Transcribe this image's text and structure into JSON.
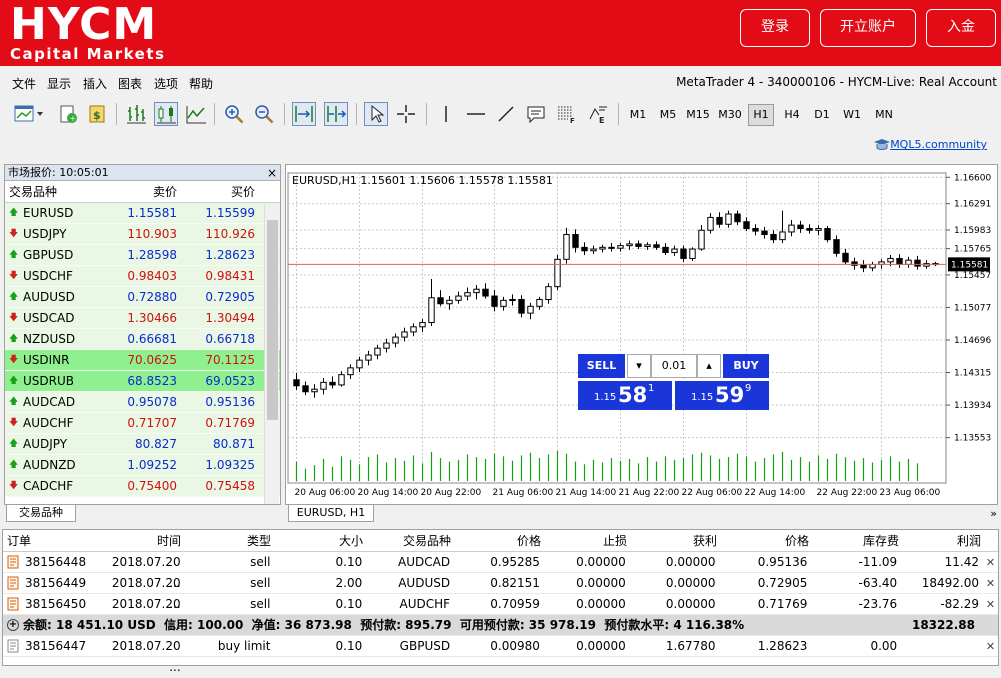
{
  "header": {
    "logo_main": "HYCM",
    "logo_sub": "Capital Markets",
    "login": "登录",
    "open_account": "开立账户",
    "deposit": "入金"
  },
  "menu": [
    "文件",
    "显示",
    "插入",
    "图表",
    "选项",
    "帮助"
  ],
  "terminal_title": "MetaTrader 4 - 340000106 - HYCM-Live: Real Account",
  "toolbar": {
    "timeframes": [
      "M1",
      "M5",
      "M15",
      "M30",
      "H1",
      "H4",
      "D1",
      "W1",
      "MN"
    ],
    "active_timeframe": "H1",
    "mql_link": "MQL5.community"
  },
  "market_watch": {
    "title": "市场报价: 10:05:01",
    "columns": [
      "交易品种",
      "卖价",
      "买价"
    ],
    "tab": "交易品种",
    "rows": [
      {
        "symbol": "EURUSD",
        "dir": "up",
        "bid": "1.15581",
        "ask": "1.15599",
        "color": "blue"
      },
      {
        "symbol": "USDJPY",
        "dir": "down",
        "bid": "110.903",
        "ask": "110.926",
        "color": "red"
      },
      {
        "symbol": "GBPUSD",
        "dir": "up",
        "bid": "1.28598",
        "ask": "1.28623",
        "color": "blue"
      },
      {
        "symbol": "USDCHF",
        "dir": "down",
        "bid": "0.98403",
        "ask": "0.98431",
        "color": "red"
      },
      {
        "symbol": "AUDUSD",
        "dir": "up",
        "bid": "0.72880",
        "ask": "0.72905",
        "color": "blue"
      },
      {
        "symbol": "USDCAD",
        "dir": "down",
        "bid": "1.30466",
        "ask": "1.30494",
        "color": "red"
      },
      {
        "symbol": "NZDUSD",
        "dir": "up",
        "bid": "0.66681",
        "ask": "0.66718",
        "color": "blue"
      },
      {
        "symbol": "USDINR",
        "dir": "down",
        "bid": "70.0625",
        "ask": "70.1125",
        "color": "red",
        "highlight": true
      },
      {
        "symbol": "USDRUB",
        "dir": "up",
        "bid": "68.8523",
        "ask": "69.0523",
        "color": "blue",
        "highlight": true
      },
      {
        "symbol": "AUDCAD",
        "dir": "up",
        "bid": "0.95078",
        "ask": "0.95136",
        "color": "blue"
      },
      {
        "symbol": "AUDCHF",
        "dir": "down",
        "bid": "0.71707",
        "ask": "0.71769",
        "color": "red"
      },
      {
        "symbol": "AUDJPY",
        "dir": "up",
        "bid": "80.827",
        "ask": "80.871",
        "color": "blue"
      },
      {
        "symbol": "AUDNZD",
        "dir": "up",
        "bid": "1.09252",
        "ask": "1.09325",
        "color": "blue"
      },
      {
        "symbol": "CADCHF",
        "dir": "down",
        "bid": "0.75400",
        "ask": "0.75458",
        "color": "red"
      }
    ]
  },
  "one_click": {
    "sell": "SELL",
    "buy": "BUY",
    "lot": "0.01",
    "sell_prefix": "1.15",
    "sell_big": "58",
    "sell_sup": "1",
    "buy_prefix": "1.15",
    "buy_big": "59",
    "buy_sup": "9"
  },
  "chart_tab": "EURUSD, H1",
  "chart_data": {
    "type": "candlestick",
    "header": "EURUSD,H1  1.15601 1.15606 1.15578 1.15581",
    "current_price_label": "1.15581",
    "current_price": 1.15581,
    "ylim": [
      1.1335,
      1.1665
    ],
    "y_ticks": [
      "1.16600",
      "1.16291",
      "1.15983",
      "1.15765",
      "1.15457",
      "1.15077",
      "1.14696",
      "1.14315",
      "1.13934",
      "1.13553"
    ],
    "y_tick_values": [
      1.166,
      1.16291,
      1.15983,
      1.15765,
      1.15457,
      1.15077,
      1.14696,
      1.14315,
      1.13934,
      1.13553
    ],
    "x_ticks": [
      "20 Aug 06:00",
      "20 Aug 14:00",
      "20 Aug 22:00",
      "21 Aug 06:00",
      "21 Aug 14:00",
      "21 Aug 22:00",
      "22 Aug 06:00",
      "22 Aug 14:00",
      "22 Aug 22:00",
      "23 Aug 06:00"
    ],
    "candles": [
      [
        1.1423,
        1.1431,
        1.1411,
        1.1416
      ],
      [
        1.1416,
        1.1421,
        1.1405,
        1.1409
      ],
      [
        1.1409,
        1.1418,
        1.1402,
        1.1412
      ],
      [
        1.1412,
        1.1425,
        1.1406,
        1.142
      ],
      [
        1.142,
        1.1427,
        1.1413,
        1.1417
      ],
      [
        1.1417,
        1.1433,
        1.1415,
        1.1429
      ],
      [
        1.1429,
        1.1441,
        1.1424,
        1.1437
      ],
      [
        1.1437,
        1.145,
        1.1432,
        1.1446
      ],
      [
        1.1446,
        1.1457,
        1.144,
        1.1452
      ],
      [
        1.1452,
        1.1464,
        1.1447,
        1.146
      ],
      [
        1.146,
        1.1471,
        1.1455,
        1.1466
      ],
      [
        1.1466,
        1.1477,
        1.1461,
        1.1473
      ],
      [
        1.1473,
        1.1484,
        1.1468,
        1.1479
      ],
      [
        1.1479,
        1.1489,
        1.1474,
        1.1485
      ],
      [
        1.1485,
        1.1494,
        1.1479,
        1.149
      ],
      [
        1.149,
        1.1541,
        1.1486,
        1.1519
      ],
      [
        1.1519,
        1.1528,
        1.1509,
        1.1512
      ],
      [
        1.1512,
        1.1521,
        1.1505,
        1.1516
      ],
      [
        1.1516,
        1.1526,
        1.1512,
        1.1521
      ],
      [
        1.1521,
        1.1531,
        1.1516,
        1.1525
      ],
      [
        1.1525,
        1.1534,
        1.1517,
        1.1529
      ],
      [
        1.1529,
        1.1536,
        1.1518,
        1.1521
      ],
      [
        1.1521,
        1.1528,
        1.1503,
        1.1509
      ],
      [
        1.1509,
        1.152,
        1.1504,
        1.1516
      ],
      [
        1.1516,
        1.1523,
        1.151,
        1.1517
      ],
      [
        1.1517,
        1.1522,
        1.1496,
        1.1501
      ],
      [
        1.1501,
        1.1513,
        1.1494,
        1.1509
      ],
      [
        1.1509,
        1.152,
        1.1505,
        1.1517
      ],
      [
        1.1517,
        1.1536,
        1.1512,
        1.1532
      ],
      [
        1.1532,
        1.1569,
        1.1528,
        1.1564
      ],
      [
        1.1564,
        1.1601,
        1.1559,
        1.1593
      ],
      [
        1.1593,
        1.1599,
        1.1572,
        1.1578
      ],
      [
        1.1578,
        1.1584,
        1.1569,
        1.1574
      ],
      [
        1.1574,
        1.158,
        1.157,
        1.1576
      ],
      [
        1.1576,
        1.1581,
        1.1572,
        1.1578
      ],
      [
        1.1578,
        1.1583,
        1.1573,
        1.1577
      ],
      [
        1.1577,
        1.1583,
        1.1573,
        1.158
      ],
      [
        1.158,
        1.1586,
        1.1575,
        1.1582
      ],
      [
        1.1582,
        1.1586,
        1.1576,
        1.1579
      ],
      [
        1.1579,
        1.1584,
        1.1575,
        1.1581
      ],
      [
        1.1581,
        1.1585,
        1.1575,
        1.1578
      ],
      [
        1.1578,
        1.1583,
        1.1569,
        1.1572
      ],
      [
        1.1572,
        1.158,
        1.1568,
        1.1576
      ],
      [
        1.1576,
        1.158,
        1.1561,
        1.1565
      ],
      [
        1.1565,
        1.1578,
        1.1562,
        1.1576
      ],
      [
        1.1576,
        1.1604,
        1.1574,
        1.1598
      ],
      [
        1.1598,
        1.1618,
        1.1594,
        1.1613
      ],
      [
        1.1613,
        1.1619,
        1.1601,
        1.1605
      ],
      [
        1.1605,
        1.1621,
        1.1601,
        1.1617
      ],
      [
        1.1617,
        1.1621,
        1.1604,
        1.1608
      ],
      [
        1.1608,
        1.1613,
        1.1597,
        1.16
      ],
      [
        1.16,
        1.1605,
        1.1592,
        1.1597
      ],
      [
        1.1597,
        1.1602,
        1.1588,
        1.1593
      ],
      [
        1.1593,
        1.1598,
        1.1583,
        1.1587
      ],
      [
        1.1587,
        1.1621,
        1.1583,
        1.1596
      ],
      [
        1.1596,
        1.161,
        1.1591,
        1.1604
      ],
      [
        1.1604,
        1.1609,
        1.1595,
        1.16
      ],
      [
        1.16,
        1.1605,
        1.1594,
        1.1598
      ],
      [
        1.1598,
        1.1604,
        1.1592,
        1.16
      ],
      [
        1.16,
        1.1603,
        1.1584,
        1.1587
      ],
      [
        1.1587,
        1.1592,
        1.1567,
        1.1571
      ],
      [
        1.1571,
        1.1576,
        1.1558,
        1.1561
      ],
      [
        1.1561,
        1.1566,
        1.1552,
        1.1557
      ],
      [
        1.1557,
        1.1563,
        1.1549,
        1.1554
      ],
      [
        1.1554,
        1.1561,
        1.155,
        1.1558
      ],
      [
        1.1558,
        1.1564,
        1.1553,
        1.1561
      ],
      [
        1.1561,
        1.1569,
        1.1556,
        1.1565
      ],
      [
        1.1565,
        1.157,
        1.1554,
        1.1558
      ],
      [
        1.1558,
        1.1567,
        1.1554,
        1.1563
      ],
      [
        1.1563,
        1.1568,
        1.1552,
        1.1556
      ],
      [
        1.1556,
        1.1563,
        1.1553,
        1.1559
      ],
      [
        1.1559,
        1.1561,
        1.1556,
        1.1558
      ]
    ],
    "volumes": [
      22,
      14,
      18,
      25,
      16,
      28,
      24,
      19,
      27,
      30,
      21,
      26,
      23,
      29,
      20,
      33,
      26,
      22,
      24,
      30,
      27,
      25,
      31,
      28,
      23,
      29,
      32,
      26,
      30,
      34,
      31,
      22,
      19,
      24,
      21,
      26,
      23,
      25,
      20,
      27,
      22,
      28,
      24,
      26,
      30,
      32,
      29,
      25,
      27,
      31,
      28,
      22,
      26,
      30,
      33,
      24,
      27,
      22,
      29,
      25,
      31,
      27,
      23,
      26,
      21,
      24,
      28,
      22,
      25,
      20
    ],
    "colors": {
      "line": "#000000",
      "bull": "#ffffff",
      "bear": "#000000",
      "volume": "#10a010",
      "price_line": "#d86a3a",
      "grid": "#c8c8c8"
    }
  },
  "trade": {
    "columns": [
      "订单",
      "时间",
      "类型",
      "大小",
      "交易品种",
      "价格",
      "止损",
      "获利",
      "价格",
      "库存费",
      "利润"
    ],
    "rows": [
      {
        "order": "38156448",
        "time": "2018.07.20 ...",
        "type": "sell",
        "size": "0.10",
        "symbol": "AUDCAD",
        "price": "0.95285",
        "sl": "0.00000",
        "tp": "0.00000",
        "cur": "0.95136",
        "swap": "-11.09",
        "profit": "11.42"
      },
      {
        "order": "38156449",
        "time": "2018.07.20 ...",
        "type": "sell",
        "size": "2.00",
        "symbol": "AUDUSD",
        "price": "0.82151",
        "sl": "0.00000",
        "tp": "0.00000",
        "cur": "0.72905",
        "swap": "-63.40",
        "profit": "18492.00"
      },
      {
        "order": "38156450",
        "time": "2018.07.20 ...",
        "type": "sell",
        "size": "0.10",
        "symbol": "AUDCHF",
        "price": "0.70959",
        "sl": "0.00000",
        "tp": "0.00000",
        "cur": "0.71769",
        "swap": "-23.76",
        "profit": "-82.29"
      }
    ],
    "balance_line": "余额: 18 451.10 USD  信用: 100.00  净值: 36 873.98  预付款: 895.79  可用预付款: 35 978.19  预付款水平: 4 116.38%",
    "balance_total": "18322.88",
    "pending": {
      "order": "38156447",
      "time": "2018.07.20 ...",
      "type": "buy limit",
      "size": "0.10",
      "symbol": "GBPUSD",
      "price": "0.00980",
      "sl": "0.00000",
      "tp": "1.67780",
      "cur": "1.28623",
      "swap": "0.00",
      "profit": ""
    }
  }
}
